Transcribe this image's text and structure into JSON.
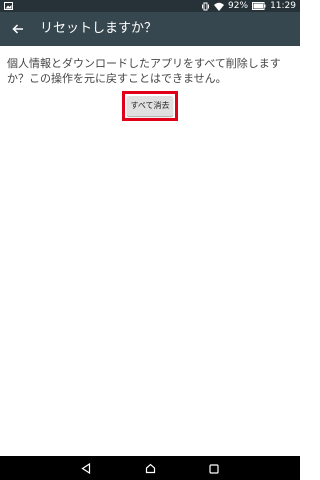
{
  "status_bar": {
    "battery_percent": "92%",
    "time": "11:29",
    "icons": [
      "notification-image-icon",
      "vibrate-icon",
      "wifi-icon",
      "battery-icon"
    ]
  },
  "toolbar": {
    "title": "リセットしますか？",
    "back_icon": "arrow-left-icon"
  },
  "content": {
    "message": "個人情報とダウンロードしたアプリをすべて削除しますか？この操作を元に戻すことはできません。",
    "erase_button_label": "すべて消去"
  },
  "highlight_color": "#e0001a",
  "nav_bar": {
    "icons": [
      "back-triangle-icon",
      "home-icon",
      "recents-icon"
    ]
  }
}
